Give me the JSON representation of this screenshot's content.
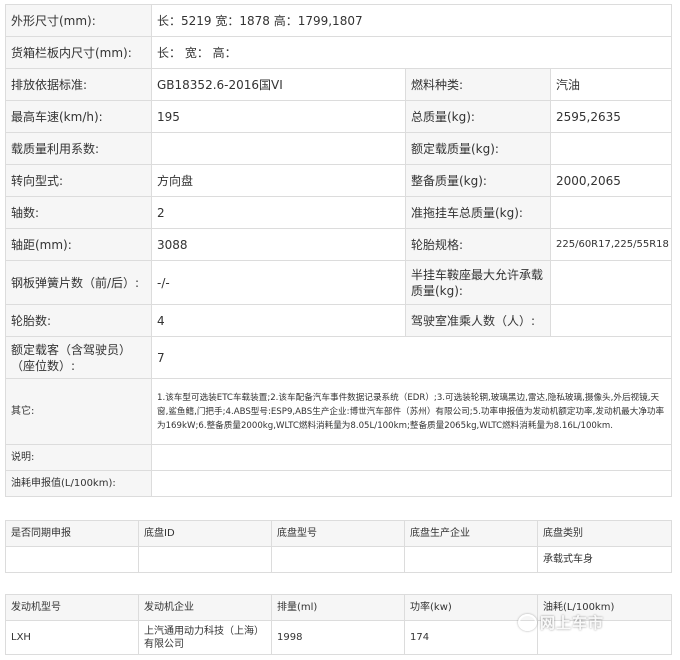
{
  "spec": {
    "outer_size_label": "外形尺寸(mm):",
    "outer_size_value": "长：5219 宽：1878 高：1799,1807",
    "cargo_box_label": "货箱栏板内尺寸(mm):",
    "cargo_box_value": "长： 宽： 高：",
    "emission_label": "排放依据标准:",
    "emission_value": "GB18352.6-2016国VI",
    "fuel_label": "燃料种类:",
    "fuel_value": "汽油",
    "max_speed_label": "最高车速(km/h):",
    "max_speed_value": "195",
    "total_mass_label": "总质量(kg):",
    "total_mass_value": "2595,2635",
    "load_util_label": "载质量利用系数:",
    "load_util_value": "",
    "rated_load_label": "额定载质量(kg):",
    "rated_load_value": "",
    "steering_label": "转向型式:",
    "steering_value": "方向盘",
    "curb_mass_label": "整备质量(kg):",
    "curb_mass_value": "2000,2065",
    "axles_label": "轴数:",
    "axles_value": "2",
    "trailer_mass_label": "准拖挂车总质量(kg):",
    "trailer_mass_value": "",
    "wheelbase_label": "轴距(mm):",
    "wheelbase_value": "3088",
    "tire_spec_label": "轮胎规格:",
    "tire_spec_value": "225/60R17,225/55R18",
    "leaf_spring_label": "钢板弹簧片数（前/后）:",
    "leaf_spring_value": "-/-",
    "saddle_load_label": "半挂车鞍座最大允许承载质量(kg):",
    "saddle_load_value": "",
    "tires_label": "轮胎数:",
    "tires_value": "4",
    "cab_seats_label": "驾驶室准乘人数（人）:",
    "cab_seats_value": "",
    "rated_passengers_label": "额定载客（含驾驶员）（座位数）:",
    "rated_passengers_value": "7",
    "other_label": "其它:",
    "other_value": "1.该车型可选装ETC车载装置;2.该车配备汽车事件数据记录系统（EDR）;3.可选装轮辋,玻璃黑边,雷达,隐私玻璃,摄像头,外后视镜,天窗,鲨鱼鳍,门把手;4.ABS型号:ESP9,ABS生产企业:博世汽车部件（苏州）有限公司;5.功率申报值为发动机额定功率,发动机最大净功率为169kW;6.整备质量2000kg,WLTC燃料消耗量为8.05L/100km;整备质量2065kg,WLTC燃料消耗量为8.16L/100km.",
    "note_label": "说明:",
    "note_value": "",
    "fuel_consumption_label": "油耗申报值(L/100km):",
    "fuel_consumption_value": ""
  },
  "chassis": {
    "headers": [
      "是否同期申报",
      "底盘ID",
      "底盘型号",
      "底盘生产企业",
      "底盘类别"
    ],
    "row": [
      "",
      "",
      "",
      "",
      "承载式车身"
    ]
  },
  "engine": {
    "headers": [
      "发动机型号",
      "发动机企业",
      "排量(ml)",
      "功率(kw)",
      "油耗(L/100km)"
    ],
    "row": [
      "LXH",
      "上汽通用动力科技（上海）有限公司",
      "1998",
      "174",
      ""
    ]
  },
  "watermark": "网上车市"
}
